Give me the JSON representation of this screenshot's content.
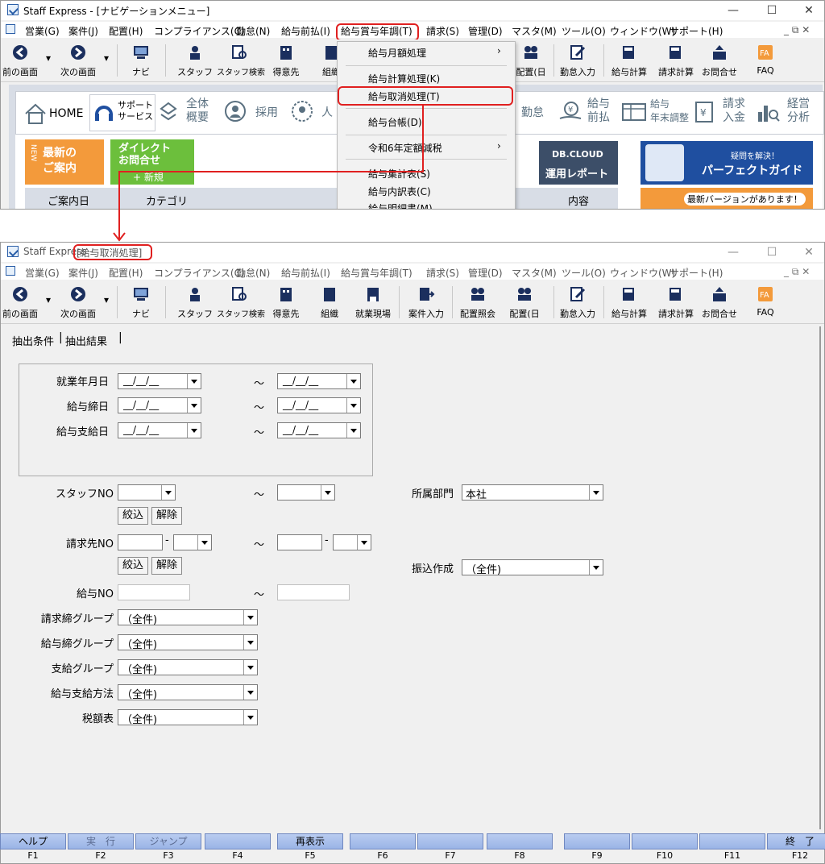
{
  "top_window": {
    "title": "Staff Express - [ナビゲーションメニュー]",
    "menu": [
      "営業(G)",
      "案件(J)",
      "配置(H)",
      "コンプライアンス(C)",
      "勤怠(N)",
      "給与前払(I)",
      "給与賞与年調(T)",
      "請求(S)",
      "管理(D)",
      "マスタ(M)",
      "ツール(O)",
      "ウィンドウ(W)",
      "サポート(H)"
    ],
    "toolbar": [
      "前の画面",
      "次の画面",
      "ナビ",
      "スタッフ",
      "スタッフ検索",
      "得意先",
      "組織",
      "配置(日",
      "勤怠入力",
      "給与計算",
      "請求計算",
      "お問合せ",
      "FAQ"
    ],
    "dropdown": [
      "給与月額処理",
      "給与計算処理(K)",
      "給与取消処理(T)",
      "給与台帳(D)",
      "令和6年定額減税",
      "給与集計表(S)",
      "給与内訳表(C)",
      "給与明細書(M)"
    ],
    "nav_tabs": [
      "HOME",
      "サポート\nサービス",
      "全体\n概要",
      "採用",
      "人",
      "勤怠",
      "給与\n前払",
      "給与\n年末調整",
      "請求\n入金",
      "経営\n分析"
    ],
    "banners": {
      "new_label": "NEW",
      "new_text": "最新の\nご案内",
      "direct_text": "ダイレクト\nお問合せ",
      "direct_sub": "+ 新規",
      "dbcloud": "DB.CLOUD",
      "dbcloud_sub": "運用レポート",
      "guide_small": "疑問を解決！",
      "guide_big": "パーフェクトガイド",
      "version": "最新バージョンがあります！"
    },
    "table_headers": [
      "ご案内日",
      "カテゴリ",
      "内容"
    ]
  },
  "bottom_window": {
    "title_prefix": "Staff Express - ",
    "title_highlight": "[給与取消処理]",
    "menu": [
      "営業(G)",
      "案件(J)",
      "配置(H)",
      "コンプライアンス(C)",
      "勤怠(N)",
      "給与前払(I)",
      "給与賞与年調(T)",
      "請求(S)",
      "管理(D)",
      "マスタ(M)",
      "ツール(O)",
      "ウィンドウ(W)",
      "サポート(H)"
    ],
    "toolbar": [
      "前の画面",
      "次の画面",
      "ナビ",
      "スタッフ",
      "スタッフ検索",
      "得意先",
      "組織",
      "就業現場",
      "案件入力",
      "配置照会",
      "配置(日",
      "勤怠入力",
      "給与計算",
      "請求計算",
      "お問合せ",
      "FAQ"
    ],
    "tabs": [
      "抽出条件",
      "抽出結果"
    ],
    "date_placeholder": "__/__/__",
    "tilde": "～",
    "form": {
      "work_month": "就業年月日",
      "pay_close": "給与締日",
      "pay_date": "給与支給日",
      "staff_no": "スタッフNO",
      "client_no": "請求先NO",
      "narrow": "絞込",
      "clear": "解除",
      "salary_no": "給与NO",
      "bill_group": "請求締グループ",
      "pay_group": "給与締グループ",
      "support_group": "支給グループ",
      "pay_method": "給与支給方法",
      "tax_table": "税額表",
      "dept": "所属部門",
      "dept_value": "本社",
      "transfer": "振込作成",
      "all": "（全件)"
    },
    "fkeys": [
      {
        "cap": "ヘルプ",
        "num": "F1"
      },
      {
        "cap": "実　行",
        "num": "F2"
      },
      {
        "cap": "ジャンプ",
        "num": "F3"
      },
      {
        "cap": "",
        "num": "F4"
      },
      {
        "cap": "再表示",
        "num": "F5"
      },
      {
        "cap": "",
        "num": "F6"
      },
      {
        "cap": "",
        "num": "F7"
      },
      {
        "cap": "",
        "num": "F8"
      },
      {
        "cap": "",
        "num": "F9"
      },
      {
        "cap": "",
        "num": "F10"
      },
      {
        "cap": "",
        "num": "F11"
      },
      {
        "cap": "終　了",
        "num": "F12"
      }
    ]
  },
  "colors": {
    "highlight": "#e02020",
    "fkey": "#a8bfeb",
    "orange": "#f39a3b",
    "green": "#6cbf3c"
  }
}
